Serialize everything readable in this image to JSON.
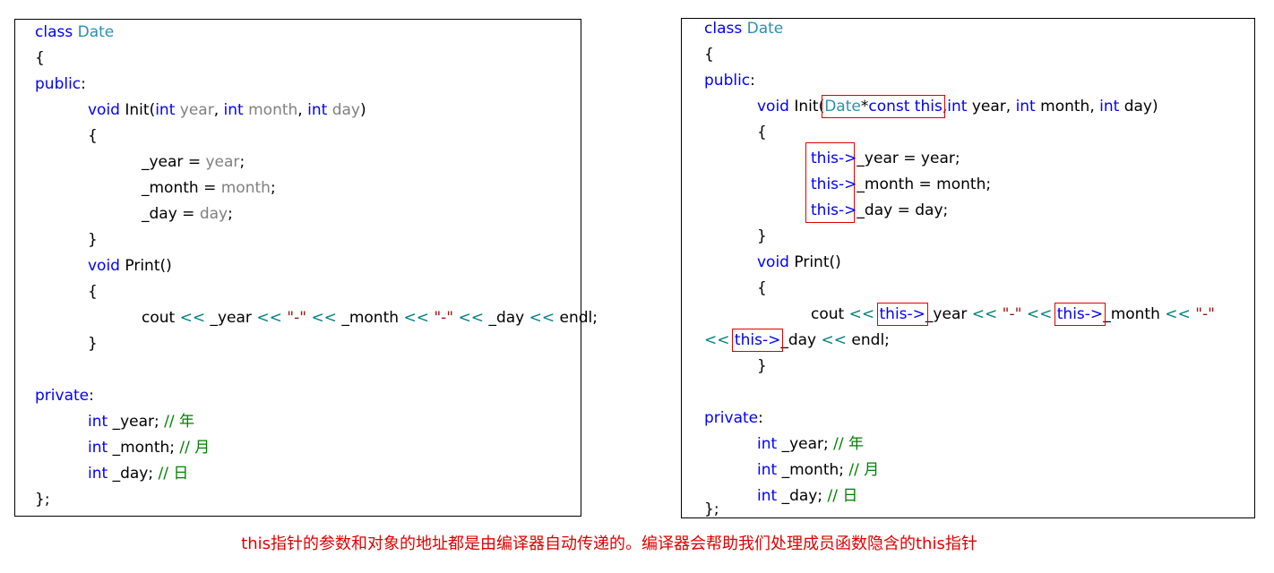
{
  "colors": {
    "keyword": "#0000ff",
    "type_name": "#2b91af",
    "parameter": "#808080",
    "operator": "#008080",
    "string": "#a31515",
    "comment": "#008000",
    "highlight_border": "#e00000",
    "caption": "#e00000"
  },
  "left": {
    "class_kw": "class",
    "class_name": "Date",
    "open_brace": "{",
    "public_kw": "public",
    "colon": ":",
    "void_kw": "void",
    "init_name": "Init(",
    "int_kw": "int",
    "year": "year",
    "month": "month",
    "day": "day",
    "comma": ",",
    "close_paren": ")",
    "year_field": "_year",
    "month_field": "_month",
    "day_field": "_day",
    "assign": " = ",
    "semicolon": ";",
    "close_brace": "}",
    "print_name": "Print()",
    "cout": "cout",
    "shift": "<<",
    "dash_str": "\"-\"",
    "endl": "endl;",
    "private_kw": "private",
    "cmt_year": "// 年",
    "cmt_month": "// 月",
    "cmt_day": "// 日",
    "class_end": "};"
  },
  "right": {
    "date_type": "Date",
    "star": "*",
    "const_kw": "const",
    "this_kw": "this",
    "arrow": "->"
  },
  "caption": "this指针的参数和对象的地址都是由编译器自动传递的。编译器会帮助我们处理成员函数隐含的this指针"
}
